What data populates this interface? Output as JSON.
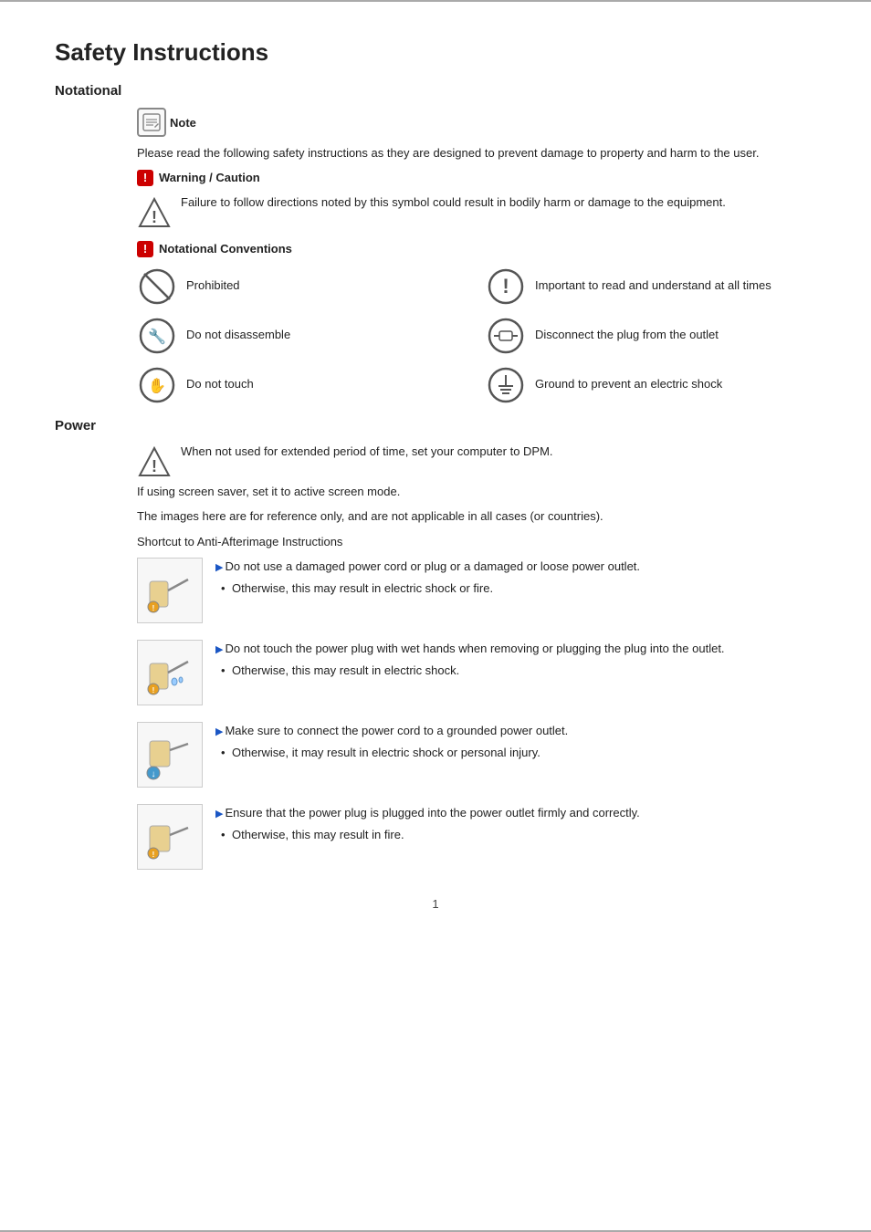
{
  "page": {
    "title": "Safety Instructions",
    "top_border": true,
    "bottom_border": true,
    "page_number": "1"
  },
  "sections": {
    "notational": {
      "heading": "Notational",
      "note_label": "Note",
      "note_body": "Please read the following safety instructions as they are designed to prevent damage to property and harm to the user.",
      "warning_label": "Warning / Caution",
      "warning_body": "Failure to follow directions noted by this symbol could result in bodily harm or damage to the equipment.",
      "conventions_heading": "Notational Conventions",
      "conventions": [
        {
          "id": "prohibited",
          "text": "Prohibited",
          "side": "left",
          "icon_type": "prohibited"
        },
        {
          "id": "important",
          "text": "Important to read and understand at all times",
          "side": "right",
          "icon_type": "important"
        },
        {
          "id": "disassemble",
          "text": "Do not disassemble",
          "side": "left",
          "icon_type": "disassemble"
        },
        {
          "id": "disconnect",
          "text": "Disconnect the plug from the outlet",
          "side": "right",
          "icon_type": "disconnect"
        },
        {
          "id": "touch",
          "text": "Do not touch",
          "side": "left",
          "icon_type": "touch"
        },
        {
          "id": "ground",
          "text": "Ground to prevent an electric shock",
          "side": "right",
          "icon_type": "ground"
        }
      ]
    },
    "power": {
      "heading": "Power",
      "warning_text1": "When not used for extended period of time, set your computer to DPM.",
      "warning_text2": "If using screen saver, set it to active screen mode.",
      "warning_text3": "The images here are for reference only, and are not applicable in all cases (or countries).",
      "warning_text4": "Shortcut to Anti-Afterimage Instructions",
      "items": [
        {
          "id": "power1",
          "main": "Do not use a damaged power cord or plug or a damaged or loose power outlet.",
          "bullet": "Otherwise, this may result in electric shock or fire."
        },
        {
          "id": "power2",
          "main": "Do not touch the power plug with wet hands when removing or plugging the plug into the outlet.",
          "bullet": "Otherwise, this may result in electric shock."
        },
        {
          "id": "power3",
          "main": "Make sure to connect the power cord to a grounded power outlet.",
          "bullet": "Otherwise, it may result in electric shock or personal injury."
        },
        {
          "id": "power4",
          "main": "Ensure that the power plug is plugged into the power outlet firmly and correctly.",
          "bullet": "Otherwise, this may result in fire."
        }
      ]
    }
  }
}
